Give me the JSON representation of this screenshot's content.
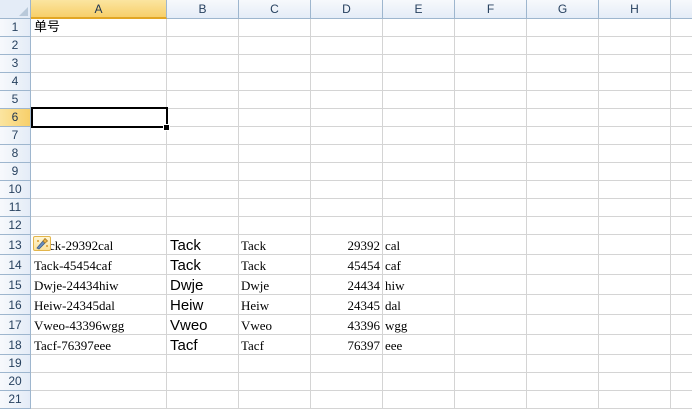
{
  "columns": [
    "A",
    "B",
    "C",
    "D",
    "E",
    "F",
    "G",
    "H"
  ],
  "rows": [
    "1",
    "2",
    "3",
    "4",
    "5",
    "6",
    "7",
    "8",
    "9",
    "10",
    "11",
    "12",
    "13",
    "14",
    "15",
    "16",
    "17",
    "18",
    "19",
    "20",
    "21"
  ],
  "active_cell": {
    "column": "A",
    "row": "6"
  },
  "cells": {
    "a1": "单号",
    "a13": "ck-29392cal",
    "a14": "Tack-45454caf",
    "a15": "Dwje-24434hiw",
    "a16": "Heiw-24345dal",
    "a17": "Vweo-43396wgg",
    "a18": "Tacf-76397eee",
    "b13": "Tack",
    "b14": "Tack",
    "b15": "Dwje",
    "b16": "Heiw",
    "b17": "Vweo",
    "b18": "Tacf",
    "c13": "Tack",
    "c14": "Tack",
    "c15": "Dwje",
    "c16": "Heiw",
    "c17": "Vweo",
    "c18": "Tacf",
    "d13": "29392",
    "d14": "45454",
    "d15": "24434",
    "d16": "24345",
    "d17": "43396",
    "d18": "76397",
    "e13": "cal",
    "e14": "caf",
    "e15": "hiw",
    "e16": "dal",
    "e17": "wgg",
    "e18": "eee"
  },
  "icons": {
    "paste_options": "paste-options-icon"
  },
  "colors": {
    "header_bg": "#e4ecf7",
    "active_header": "#f7cf6a",
    "gridline": "#d4d4d4",
    "header_text": "#27415f"
  }
}
